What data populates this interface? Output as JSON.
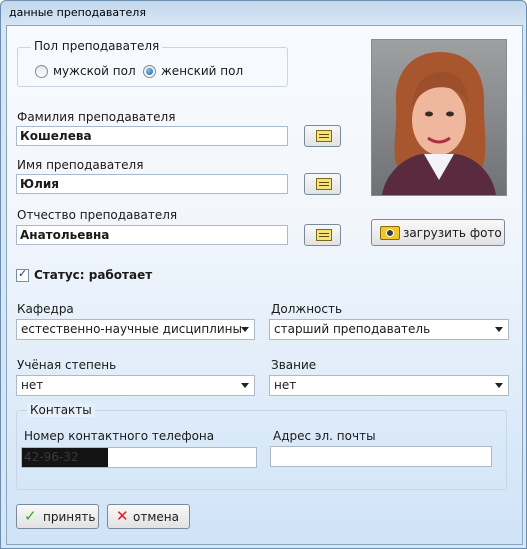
{
  "window": {
    "title": "данные преподавателя"
  },
  "gender": {
    "group_title": "Пол  преподавателя",
    "male_label": "мужской пол",
    "female_label": "женский пол",
    "selected": "женский пол"
  },
  "surname": {
    "label": "Фамилия преподавателя",
    "value": "Кошелева"
  },
  "first_name": {
    "label": "Имя преподавателя",
    "value": "Юлия"
  },
  "patronymic": {
    "label": "Отчество преподавателя",
    "value": "Анатольевна"
  },
  "photo": {
    "upload_label": "загрузить фото",
    "icon": "camera-icon"
  },
  "status": {
    "label": "Статус: работает",
    "checked": true
  },
  "department": {
    "label": "Кафедра",
    "value": "естественно-научные дисциплины"
  },
  "position": {
    "label": "Должность",
    "value": "старший преподаватель"
  },
  "degree": {
    "label": "Учёная степень",
    "value": "нет"
  },
  "rank": {
    "label": "Звание",
    "value": "нет"
  },
  "contacts": {
    "group_title": "Контакты",
    "phone_label": "Номер контактного телефона",
    "phone_value": "42-96-32",
    "email_label": "Адрес эл. почты",
    "email_value": ""
  },
  "buttons": {
    "accept_label": "принять",
    "cancel_label": "отмена"
  }
}
